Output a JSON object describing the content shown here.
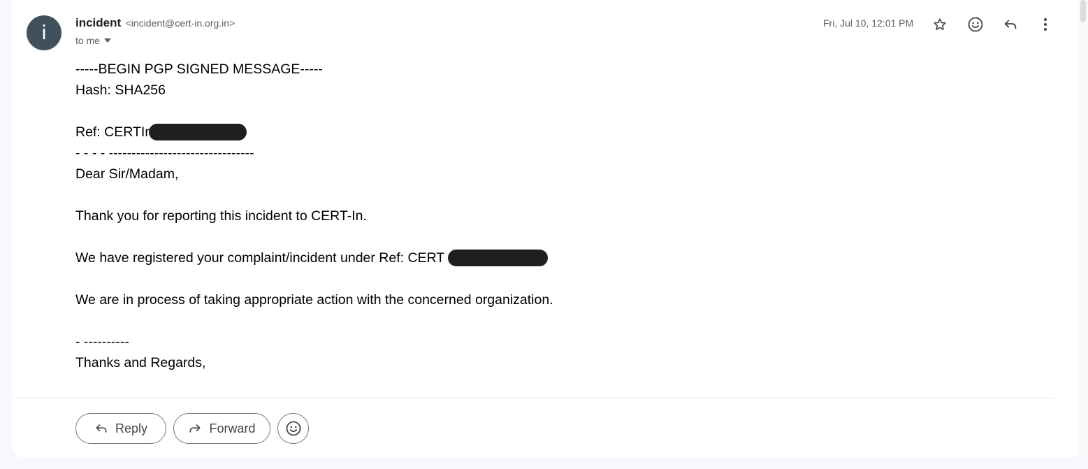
{
  "message": {
    "avatar_letter": "i",
    "sender_name": "incident",
    "sender_email": "<incident@cert-in.org.in>",
    "recipient_label": "to me",
    "date": "Fri, Jul 10, 12:01 PM",
    "body_lines": [
      "-----BEGIN PGP SIGNED MESSAGE-----",
      "Hash: SHA256",
      "",
      "Ref: CERTIn",
      "- - - - --------------------------------",
      "Dear Sir/Madam,",
      "",
      "Thank you for reporting this incident to CERT-In.",
      "",
      "We have registered your complaint/incident under Ref: CERT",
      "",
      "We are in process of taking appropriate action with the concerned organization.",
      "",
      "- ----------",
      "Thanks and Regards,"
    ],
    "clipped_line": "CERT-In"
  },
  "header_icons": [
    "star-icon",
    "emoji-icon",
    "reply-icon",
    "more-vert-icon"
  ],
  "actions": {
    "reply_label": "Reply",
    "forward_label": "Forward"
  },
  "colors": {
    "avatar_bg": "#41505b",
    "page_bg": "#f6f8fc",
    "redaction": "#1f1f1f"
  }
}
